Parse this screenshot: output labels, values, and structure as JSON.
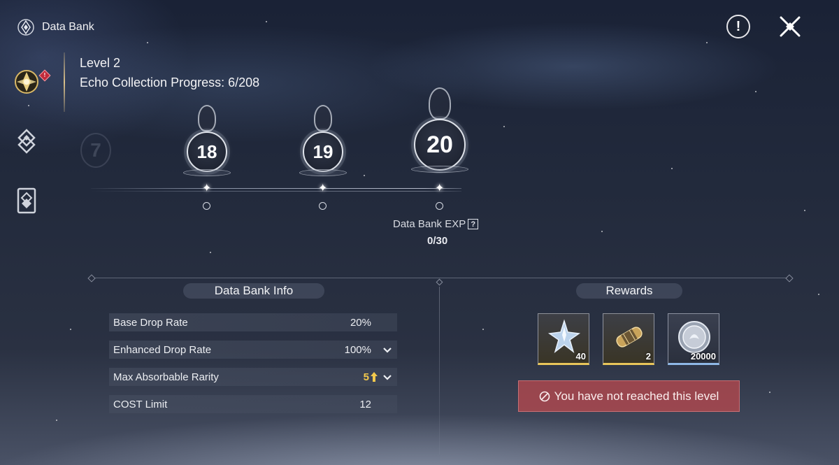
{
  "header": {
    "title": "Data Bank"
  },
  "level_info": {
    "level_label": "Level 2",
    "progress_label": "Echo Collection Progress: 6/208"
  },
  "track": {
    "ghost_level": "7",
    "nodes": [
      {
        "level": "18"
      },
      {
        "level": "19"
      },
      {
        "level": "20"
      }
    ],
    "exp_label": "Data Bank EXP",
    "exp_value": "0/30"
  },
  "info_section": {
    "title": "Data Bank Info",
    "rows": [
      {
        "label": "Base Drop Rate",
        "value": "20%"
      },
      {
        "label": "Enhanced Drop Rate",
        "value": "100%"
      },
      {
        "label": "Max Absorbable Rarity",
        "value": "5"
      },
      {
        "label": "COST Limit",
        "value": "12"
      }
    ]
  },
  "rewards_section": {
    "title": "Rewards",
    "items": [
      {
        "icon": "crystal-star-icon",
        "count": "40",
        "tier_color": "#e8c55a"
      },
      {
        "icon": "capsule-icon",
        "count": "2",
        "tier_color": "#e8c55a"
      },
      {
        "icon": "coin-icon",
        "count": "20000",
        "tier_color": "#8fb8e6"
      }
    ],
    "status": "You have not reached this level"
  },
  "colors": {
    "accent_gold": "#f2c94c",
    "status_red": "#b0484e",
    "badge_red": "#c22a3a"
  }
}
